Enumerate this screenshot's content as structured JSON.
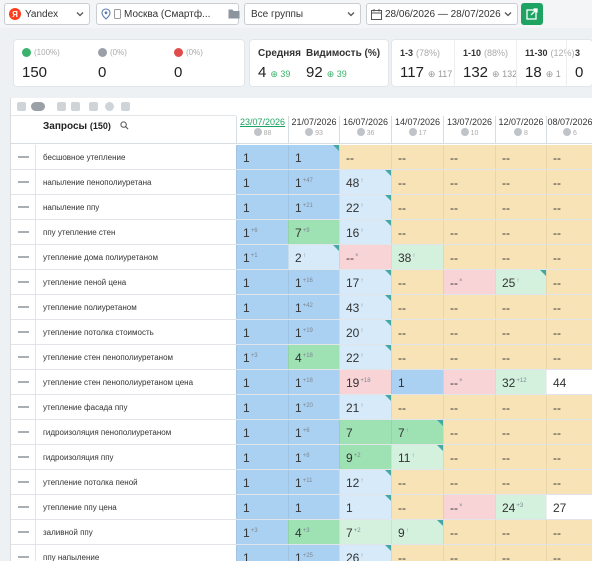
{
  "toolbar": {
    "engine": "Yandex",
    "region": "Москва (Смартф...",
    "group": "Все группы",
    "daterange": "28/06/2026 — 28/07/2026"
  },
  "stats": {
    "green": {
      "pct": "(100%)",
      "value": "150"
    },
    "neutral": {
      "pct": "(0%)",
      "value": "0"
    },
    "red": {
      "pct": "(0%)",
      "value": "0"
    },
    "avg": {
      "label": "Средняя",
      "value": "4",
      "delta": "39"
    },
    "vis": {
      "label": "Видимость (%)",
      "value": "92",
      "delta": "39"
    },
    "ranges": [
      {
        "label": "1-3",
        "pct": "(78%)",
        "value": "117",
        "delta": "117"
      },
      {
        "label": "1-10",
        "pct": "(88%)",
        "value": "132",
        "delta": "132"
      },
      {
        "label": "11-30",
        "pct": "(12%)",
        "value": "18",
        "delta": "1"
      },
      {
        "label": "3",
        "pct": "",
        "value": "0",
        "delta": ""
      }
    ]
  },
  "table": {
    "title": "Запросы",
    "count": "(150)",
    "dates": [
      {
        "date": "23/07/2026",
        "sub": "88"
      },
      {
        "date": "21/07/2026",
        "sub": "93"
      },
      {
        "date": "16/07/2026",
        "sub": "36"
      },
      {
        "date": "14/07/2026",
        "sub": "17"
      },
      {
        "date": "13/07/2026",
        "sub": "10"
      },
      {
        "date": "12/07/2026",
        "sub": "8"
      },
      {
        "date": "08/07/2026",
        "sub": "6"
      }
    ],
    "rows": [
      {
        "q": "бесшовное утепление",
        "cells": [
          {
            "v": "1",
            "d": "",
            "c": "blue",
            "t": false
          },
          {
            "v": "1",
            "d": "",
            "c": "blue",
            "t": true
          },
          {
            "v": "--",
            "d": "",
            "c": "yellow",
            "t": false
          },
          {
            "v": "--",
            "d": "",
            "c": "yellow",
            "t": false
          },
          {
            "v": "--",
            "d": "",
            "c": "yellow",
            "t": false
          },
          {
            "v": "--",
            "d": "",
            "c": "yellow",
            "t": false
          },
          {
            "v": "--",
            "d": "",
            "c": "yellow",
            "t": false
          }
        ]
      },
      {
        "q": "напыление пенополиуретана",
        "cells": [
          {
            "v": "1",
            "d": "",
            "c": "blue",
            "t": false
          },
          {
            "v": "1",
            "d": "+47",
            "c": "blue",
            "t": false
          },
          {
            "v": "48",
            "d": "↑",
            "c": "azure",
            "t": true
          },
          {
            "v": "--",
            "d": "",
            "c": "yellow",
            "t": false
          },
          {
            "v": "--",
            "d": "",
            "c": "yellow",
            "t": false
          },
          {
            "v": "--",
            "d": "",
            "c": "yellow",
            "t": false
          },
          {
            "v": "--",
            "d": "",
            "c": "yellow",
            "t": false
          }
        ]
      },
      {
        "q": "напыление ппу",
        "cells": [
          {
            "v": "1",
            "d": "",
            "c": "blue",
            "t": false
          },
          {
            "v": "1",
            "d": "+21",
            "c": "blue",
            "t": false
          },
          {
            "v": "22",
            "d": "↑",
            "c": "azure",
            "t": true
          },
          {
            "v": "--",
            "d": "",
            "c": "yellow",
            "t": false
          },
          {
            "v": "--",
            "d": "",
            "c": "yellow",
            "t": false
          },
          {
            "v": "--",
            "d": "",
            "c": "yellow",
            "t": false
          },
          {
            "v": "--",
            "d": "",
            "c": "yellow",
            "t": false
          }
        ]
      },
      {
        "q": "ппу утепление стен",
        "cells": [
          {
            "v": "1",
            "d": "+6",
            "c": "blue",
            "t": false
          },
          {
            "v": "7",
            "d": "+9",
            "c": "green",
            "t": false
          },
          {
            "v": "16",
            "d": "↑",
            "c": "azure",
            "t": true
          },
          {
            "v": "--",
            "d": "",
            "c": "yellow",
            "t": false
          },
          {
            "v": "--",
            "d": "",
            "c": "yellow",
            "t": false
          },
          {
            "v": "--",
            "d": "",
            "c": "yellow",
            "t": false
          },
          {
            "v": "--",
            "d": "",
            "c": "yellow",
            "t": false
          }
        ]
      },
      {
        "q": "утепление дома полиуретаном",
        "cells": [
          {
            "v": "1",
            "d": "+1",
            "c": "blue",
            "t": false
          },
          {
            "v": "2",
            "d": "↑",
            "c": "azure",
            "t": true
          },
          {
            "v": "--",
            "d": "×",
            "c": "red",
            "t": false
          },
          {
            "v": "38",
            "d": "↑",
            "c": "lgreen",
            "t": false
          },
          {
            "v": "--",
            "d": "",
            "c": "yellow",
            "t": false
          },
          {
            "v": "--",
            "d": "",
            "c": "yellow",
            "t": false
          },
          {
            "v": "--",
            "d": "",
            "c": "yellow",
            "t": false
          }
        ]
      },
      {
        "q": "утепление пеной цена",
        "cells": [
          {
            "v": "1",
            "d": "",
            "c": "blue",
            "t": false
          },
          {
            "v": "1",
            "d": "+16",
            "c": "blue",
            "t": false
          },
          {
            "v": "17",
            "d": "↑",
            "c": "azure",
            "t": true
          },
          {
            "v": "--",
            "d": "",
            "c": "yellow",
            "t": false
          },
          {
            "v": "--",
            "d": "×",
            "c": "red",
            "t": false
          },
          {
            "v": "25",
            "d": "↑",
            "c": "lgreen",
            "t": true
          },
          {
            "v": "--",
            "d": "",
            "c": "yellow",
            "t": false
          }
        ]
      },
      {
        "q": "утепление полиуретаном",
        "cells": [
          {
            "v": "1",
            "d": "",
            "c": "blue",
            "t": false
          },
          {
            "v": "1",
            "d": "+42",
            "c": "blue",
            "t": false
          },
          {
            "v": "43",
            "d": "↑",
            "c": "azure",
            "t": true
          },
          {
            "v": "--",
            "d": "",
            "c": "yellow",
            "t": false
          },
          {
            "v": "--",
            "d": "",
            "c": "yellow",
            "t": false
          },
          {
            "v": "--",
            "d": "",
            "c": "yellow",
            "t": false
          },
          {
            "v": "--",
            "d": "",
            "c": "yellow",
            "t": false
          }
        ]
      },
      {
        "q": "утепление потолка стоимость",
        "cells": [
          {
            "v": "1",
            "d": "",
            "c": "blue",
            "t": false
          },
          {
            "v": "1",
            "d": "+19",
            "c": "blue",
            "t": false
          },
          {
            "v": "20",
            "d": "↑",
            "c": "azure",
            "t": true
          },
          {
            "v": "--",
            "d": "",
            "c": "yellow",
            "t": false
          },
          {
            "v": "--",
            "d": "",
            "c": "yellow",
            "t": false
          },
          {
            "v": "--",
            "d": "",
            "c": "yellow",
            "t": false
          },
          {
            "v": "--",
            "d": "",
            "c": "yellow",
            "t": false
          }
        ]
      },
      {
        "q": "утепление стен пенополиуретаном",
        "cells": [
          {
            "v": "1",
            "d": "+3",
            "c": "blue",
            "t": false
          },
          {
            "v": "4",
            "d": "+18",
            "c": "green",
            "t": false
          },
          {
            "v": "22",
            "d": "↑",
            "c": "azure",
            "t": true
          },
          {
            "v": "--",
            "d": "",
            "c": "yellow",
            "t": false
          },
          {
            "v": "--",
            "d": "",
            "c": "yellow",
            "t": false
          },
          {
            "v": "--",
            "d": "",
            "c": "yellow",
            "t": false
          },
          {
            "v": "--",
            "d": "",
            "c": "yellow",
            "t": false
          }
        ]
      },
      {
        "q": "утепление стен пенополиуретаном цена",
        "cells": [
          {
            "v": "1",
            "d": "",
            "c": "blue",
            "t": false
          },
          {
            "v": "1",
            "d": "+18",
            "c": "blue",
            "t": false
          },
          {
            "v": "19",
            "d": "+18",
            "c": "red",
            "t": false
          },
          {
            "v": "1",
            "d": "",
            "c": "blue",
            "t": false
          },
          {
            "v": "--",
            "d": "×",
            "c": "red",
            "t": false
          },
          {
            "v": "32",
            "d": "+12",
            "c": "lgreen",
            "t": false
          },
          {
            "v": "44",
            "d": "",
            "c": "white",
            "t": false
          }
        ]
      },
      {
        "q": "утепление фасада ппу",
        "cells": [
          {
            "v": "1",
            "d": "",
            "c": "blue",
            "t": false
          },
          {
            "v": "1",
            "d": "+20",
            "c": "blue",
            "t": false
          },
          {
            "v": "21",
            "d": "↑",
            "c": "azure",
            "t": true
          },
          {
            "v": "--",
            "d": "",
            "c": "yellow",
            "t": false
          },
          {
            "v": "--",
            "d": "",
            "c": "yellow",
            "t": false
          },
          {
            "v": "--",
            "d": "",
            "c": "yellow",
            "t": false
          },
          {
            "v": "--",
            "d": "",
            "c": "yellow",
            "t": false
          }
        ]
      },
      {
        "q": "гидроизоляция пенополиуретаном",
        "cells": [
          {
            "v": "1",
            "d": "",
            "c": "blue",
            "t": false
          },
          {
            "v": "1",
            "d": "+6",
            "c": "blue",
            "t": false
          },
          {
            "v": "7",
            "d": "",
            "c": "green",
            "t": false
          },
          {
            "v": "7",
            "d": "↑",
            "c": "green",
            "t": true
          },
          {
            "v": "--",
            "d": "",
            "c": "yellow",
            "t": false
          },
          {
            "v": "--",
            "d": "",
            "c": "yellow",
            "t": false
          },
          {
            "v": "--",
            "d": "",
            "c": "yellow",
            "t": false
          }
        ]
      },
      {
        "q": "гидроизоляция ппу",
        "cells": [
          {
            "v": "1",
            "d": "",
            "c": "blue",
            "t": false
          },
          {
            "v": "1",
            "d": "+8",
            "c": "blue",
            "t": false
          },
          {
            "v": "9",
            "d": "+2",
            "c": "green",
            "t": false
          },
          {
            "v": "11",
            "d": "↑",
            "c": "lgreen",
            "t": true
          },
          {
            "v": "--",
            "d": "",
            "c": "yellow",
            "t": false
          },
          {
            "v": "--",
            "d": "",
            "c": "yellow",
            "t": false
          },
          {
            "v": "--",
            "d": "",
            "c": "yellow",
            "t": false
          }
        ]
      },
      {
        "q": "утепление потолка пеной",
        "cells": [
          {
            "v": "1",
            "d": "",
            "c": "blue",
            "t": false
          },
          {
            "v": "1",
            "d": "+11",
            "c": "blue",
            "t": false
          },
          {
            "v": "12",
            "d": "↑",
            "c": "azure",
            "t": true
          },
          {
            "v": "--",
            "d": "",
            "c": "yellow",
            "t": false
          },
          {
            "v": "--",
            "d": "",
            "c": "yellow",
            "t": false
          },
          {
            "v": "--",
            "d": "",
            "c": "yellow",
            "t": false
          },
          {
            "v": "--",
            "d": "",
            "c": "yellow",
            "t": false
          }
        ]
      },
      {
        "q": "утепление ппу цена",
        "cells": [
          {
            "v": "1",
            "d": "",
            "c": "blue",
            "t": false
          },
          {
            "v": "1",
            "d": "",
            "c": "blue",
            "t": false
          },
          {
            "v": "1",
            "d": "",
            "c": "azure",
            "t": true
          },
          {
            "v": "--",
            "d": "",
            "c": "yellow",
            "t": false
          },
          {
            "v": "--",
            "d": "×",
            "c": "red",
            "t": false
          },
          {
            "v": "24",
            "d": "+3",
            "c": "lgreen",
            "t": false
          },
          {
            "v": "27",
            "d": "",
            "c": "white",
            "t": false
          }
        ]
      },
      {
        "q": "заливной ппу",
        "cells": [
          {
            "v": "1",
            "d": "+3",
            "c": "blue",
            "t": false
          },
          {
            "v": "4",
            "d": "+3",
            "c": "green",
            "t": false
          },
          {
            "v": "7",
            "d": "+2",
            "c": "lgreen",
            "t": false
          },
          {
            "v": "9",
            "d": "↑",
            "c": "lgreen",
            "t": true
          },
          {
            "v": "--",
            "d": "",
            "c": "yellow",
            "t": false
          },
          {
            "v": "--",
            "d": "",
            "c": "yellow",
            "t": false
          },
          {
            "v": "--",
            "d": "",
            "c": "yellow",
            "t": false
          }
        ]
      },
      {
        "q": "ппу напыление",
        "cells": [
          {
            "v": "1",
            "d": "",
            "c": "blue",
            "t": false
          },
          {
            "v": "1",
            "d": "+25",
            "c": "blue",
            "t": false
          },
          {
            "v": "26",
            "d": "↑",
            "c": "azure",
            "t": true
          },
          {
            "v": "--",
            "d": "",
            "c": "yellow",
            "t": false
          },
          {
            "v": "--",
            "d": "",
            "c": "yellow",
            "t": false
          },
          {
            "v": "--",
            "d": "",
            "c": "yellow",
            "t": false
          },
          {
            "v": "--",
            "d": "",
            "c": "yellow",
            "t": false
          }
        ]
      }
    ]
  }
}
